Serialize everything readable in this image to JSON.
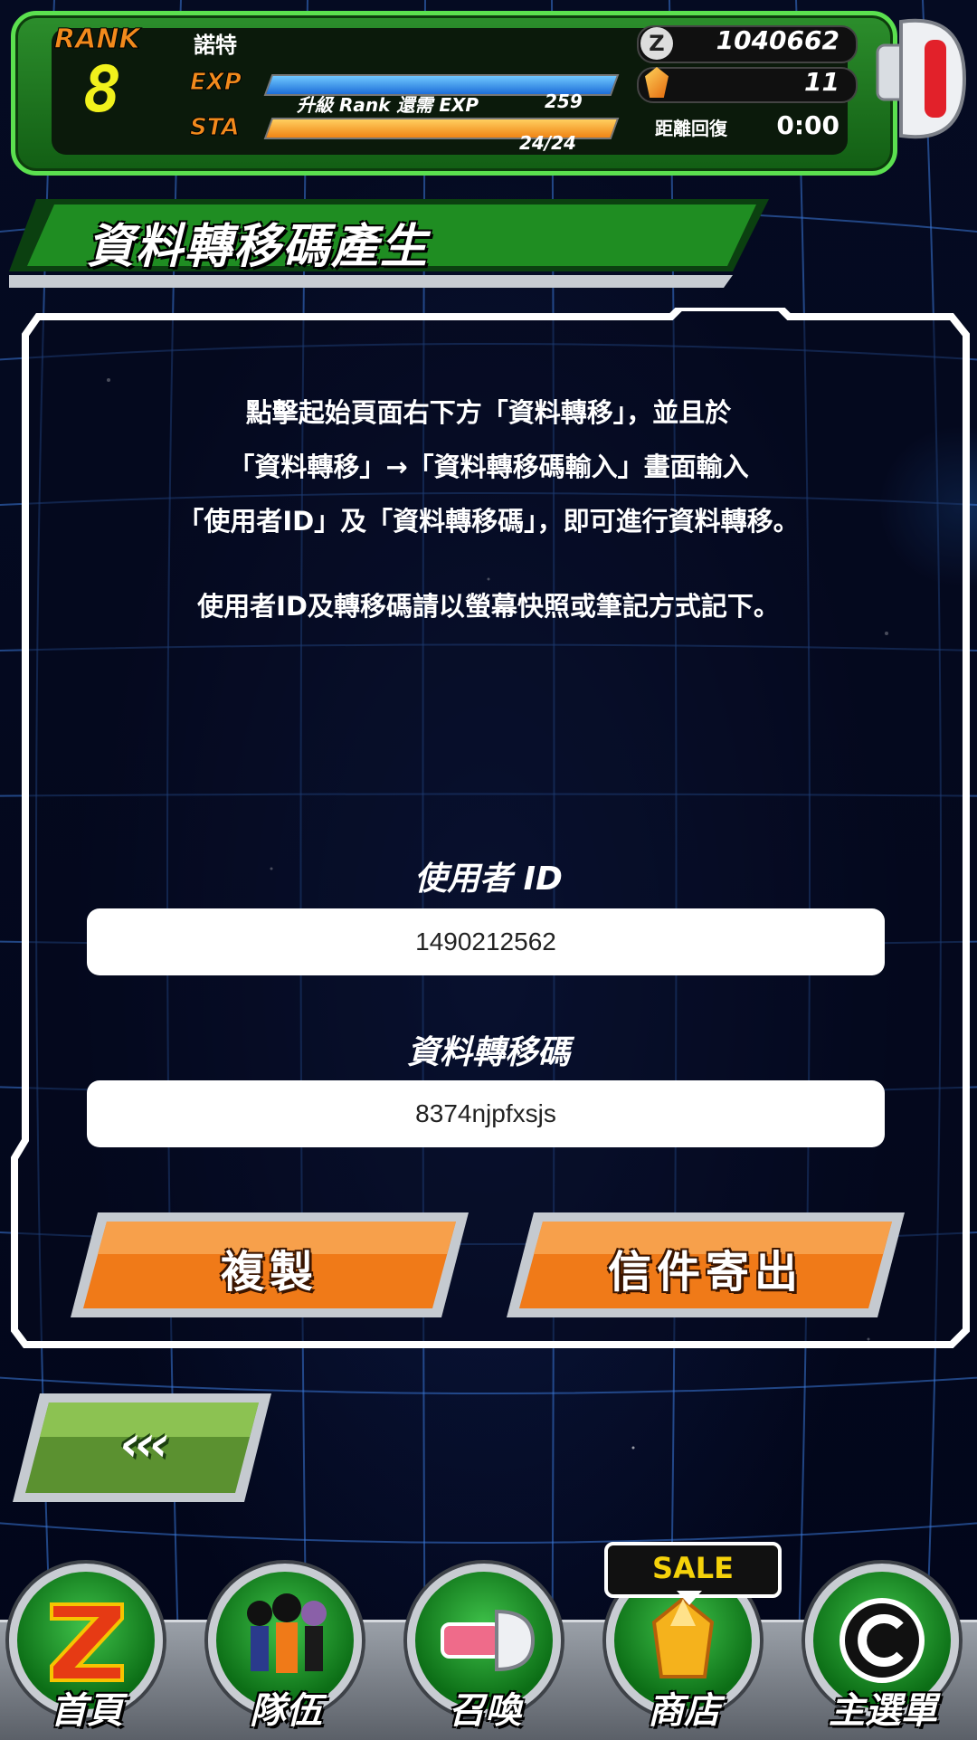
{
  "hud": {
    "rank_label": "RANK",
    "rank_value": "8",
    "player_name": "諾特",
    "exp_label": "EXP",
    "exp_note": "升級 Rank 還需 EXP",
    "exp_remaining": "259",
    "exp_progress": 1.0,
    "sta_label": "STA",
    "sta_value": "24/24",
    "sta_progress": 1.0,
    "zeni": "1040662",
    "stones": "11",
    "recover_label": "距離回復",
    "recover_time": "0:00"
  },
  "title": "資料轉移碼產生",
  "instructions": {
    "line1": "點擊起始頁面右下方「資料轉移」，並且於",
    "line2": "「資料轉移」→「資料轉移碼輸入」畫面輸入",
    "line3": "「使用者ID」及「資料轉移碼」，即可進行資料轉移。",
    "line4": "使用者ID及轉移碼請以螢幕快照或筆記方式記下。"
  },
  "user_id": {
    "label": "使用者 ID",
    "value": "1490212562"
  },
  "transfer_code": {
    "label": "資料轉移碼",
    "value": "8374njpfxsjs"
  },
  "buttons": {
    "copy": "複製",
    "email": "信件寄出",
    "back": "‹‹‹"
  },
  "nav": {
    "home": "首頁",
    "team": "隊伍",
    "summon": "召喚",
    "shop": "商店",
    "menu": "主選單",
    "sale_badge": "SALE"
  },
  "colors": {
    "hud_green": "#2c8e2c",
    "accent_orange": "#f28a1c",
    "button_orange": "#f07a18",
    "back_green": "#6da83a"
  }
}
